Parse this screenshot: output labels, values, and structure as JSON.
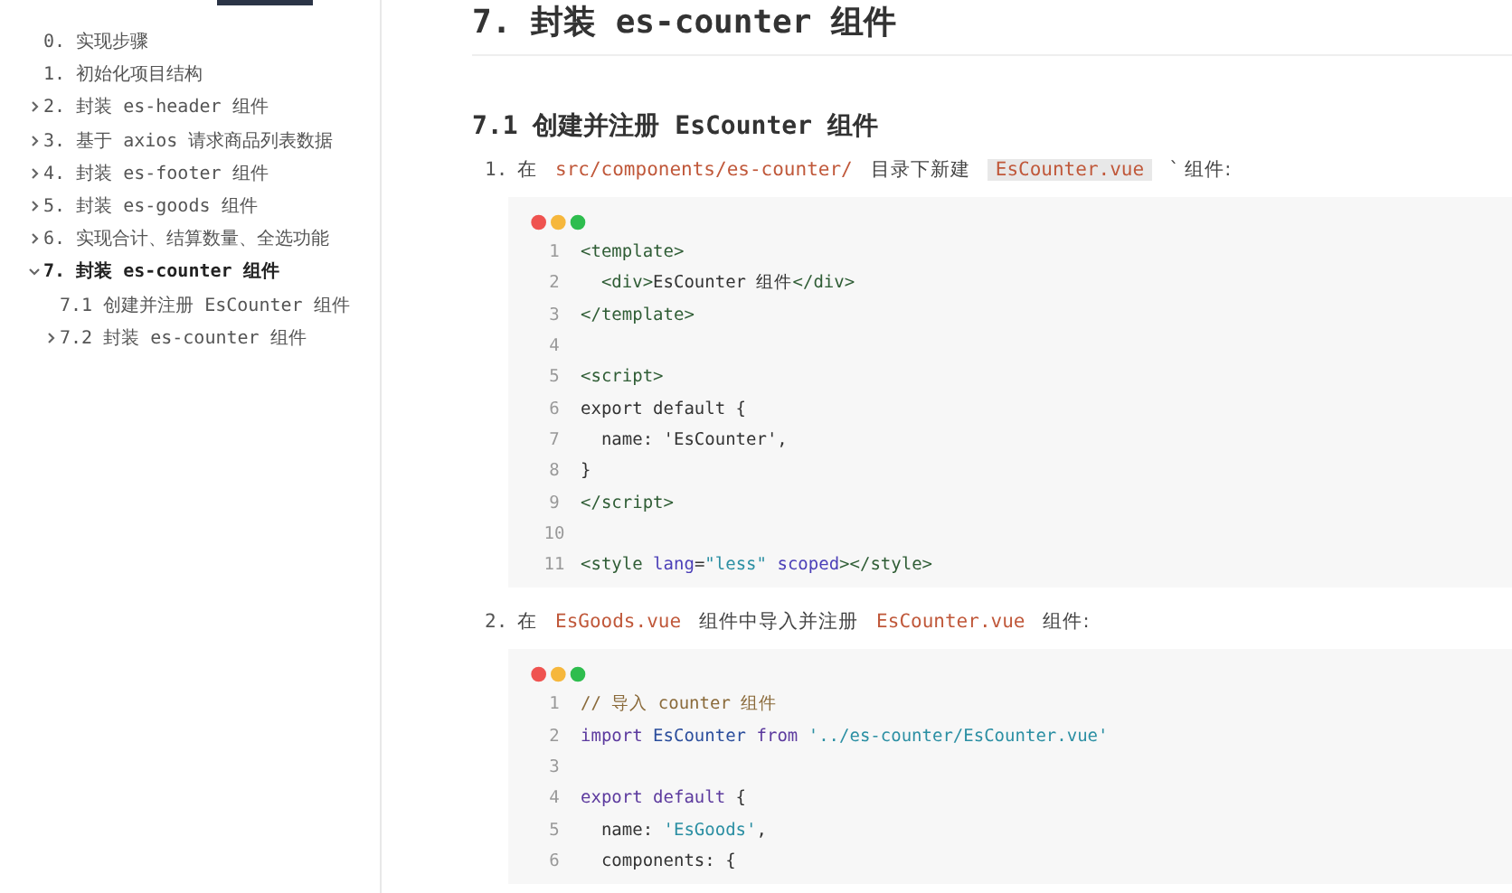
{
  "sidebar": {
    "items": [
      {
        "label": "0. 实现步骤",
        "kind": "leaf",
        "selected": false
      },
      {
        "label": "1. 初始化项目结构",
        "kind": "leaf",
        "selected": false
      },
      {
        "label": "2. 封装 es-header 组件",
        "kind": "group",
        "expanded": false,
        "selected": false
      },
      {
        "label": "3. 基于 axios 请求商品列表数据",
        "kind": "group",
        "expanded": false,
        "selected": false
      },
      {
        "label": "4. 封装 es-footer 组件",
        "kind": "group",
        "expanded": false,
        "selected": false
      },
      {
        "label": "5. 封装 es-goods 组件",
        "kind": "group",
        "expanded": false,
        "selected": false
      },
      {
        "label": "6. 实现合计、结算数量、全选功能",
        "kind": "group",
        "expanded": false,
        "selected": false
      },
      {
        "label": "7. 封装 es-counter 组件",
        "kind": "group",
        "expanded": true,
        "selected": true,
        "children": [
          {
            "label": "7.1 创建并注册 EsCounter 组件",
            "kind": "leaf",
            "selected": false
          },
          {
            "label": "7.2 封装 es-counter 组件",
            "kind": "group",
            "expanded": false,
            "selected": false
          }
        ]
      }
    ]
  },
  "article": {
    "title": "7. 封装 es-counter 组件",
    "subtitle": "7.1 创建并注册 EsCounter 组件",
    "steps": [
      {
        "number": "1.",
        "parts": [
          {
            "kind": "text",
            "text": "在"
          },
          {
            "kind": "code",
            "text": "src/components/es-counter/"
          },
          {
            "kind": "text",
            "text": "目录下新建"
          },
          {
            "kind": "selected-code",
            "text": "EsCounter.vue"
          },
          {
            "kind": "text",
            "text": "` 组件:"
          }
        ],
        "code": [
          {
            "n": "1",
            "tokens": [
              {
                "kind": "tag",
                "text": "<template>"
              }
            ]
          },
          {
            "n": "2",
            "tokens": [
              {
                "kind": "tag",
                "text": "  <div>"
              },
              {
                "kind": "plain",
                "text": "EsCounter 组件"
              },
              {
                "kind": "tag",
                "text": "</div>"
              }
            ]
          },
          {
            "n": "3",
            "tokens": [
              {
                "kind": "tag",
                "text": "</template>"
              }
            ]
          },
          {
            "n": "4"
          },
          {
            "n": "5",
            "tokens": [
              {
                "kind": "tag",
                "text": "<script>"
              }
            ]
          },
          {
            "n": "6",
            "tokens": [
              {
                "kind": "plain",
                "text": "export default {"
              }
            ]
          },
          {
            "n": "7",
            "tokens": [
              {
                "kind": "plain",
                "text": "  name: 'EsCounter',"
              }
            ]
          },
          {
            "n": "8",
            "tokens": [
              {
                "kind": "plain",
                "text": "}"
              }
            ]
          },
          {
            "n": "9",
            "tokens": [
              {
                "kind": "tag",
                "text": "</script>"
              }
            ]
          },
          {
            "n": "10"
          },
          {
            "n": "11",
            "tokens": [
              {
                "kind": "tag",
                "text": "<style "
              },
              {
                "kind": "attr",
                "text": "lang"
              },
              {
                "kind": "plain",
                "text": "="
              },
              {
                "kind": "string",
                "text": "\"less\" "
              },
              {
                "kind": "attr",
                "text": "scoped"
              },
              {
                "kind": "tag",
                "text": "></style>"
              }
            ]
          }
        ]
      },
      {
        "number": "2.",
        "parts": [
          {
            "kind": "text",
            "text": "在"
          },
          {
            "kind": "code",
            "text": "EsGoods.vue"
          },
          {
            "kind": "text",
            "text": "组件中导入并注册"
          },
          {
            "kind": "code",
            "text": "EsCounter.vue"
          },
          {
            "kind": "text",
            "text": "组件:"
          }
        ],
        "code": [
          {
            "n": "1",
            "tokens": [
              {
                "kind": "comment",
                "text": "// 导入 counter 组件"
              }
            ]
          },
          {
            "n": "2",
            "tokens": [
              {
                "kind": "keyword",
                "text": "import "
              },
              {
                "kind": "class",
                "text": "EsCounter "
              },
              {
                "kind": "keyword",
                "text": "from "
              },
              {
                "kind": "string",
                "text": "'../es-counter/EsCounter.vue'"
              }
            ]
          },
          {
            "n": "3"
          },
          {
            "n": "4",
            "tokens": [
              {
                "kind": "keyword",
                "text": "export default"
              },
              {
                "kind": "plain",
                "text": " {"
              }
            ]
          },
          {
            "n": "5",
            "tokens": [
              {
                "kind": "plain",
                "text": "  name: "
              },
              {
                "kind": "string",
                "text": "'EsGoods'"
              },
              {
                "kind": "plain",
                "text": ","
              }
            ]
          },
          {
            "n": "6",
            "tokens": [
              {
                "kind": "plain",
                "text": "  components: {"
              }
            ]
          }
        ]
      }
    ]
  }
}
